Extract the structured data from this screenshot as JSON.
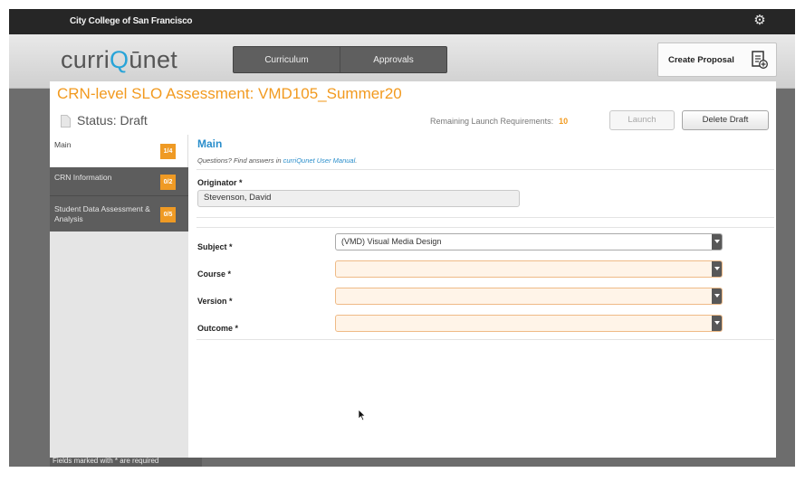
{
  "topbar": {
    "college": "City College of San Francisco",
    "settings_icon": "gear-icon"
  },
  "header": {
    "logo_prefix": "curri",
    "logo_q": "Q",
    "logo_suffix": "ūnet",
    "nav": [
      {
        "label": "Curriculum"
      },
      {
        "label": "Approvals"
      }
    ],
    "create_proposal_label": "Create Proposal",
    "create_proposal_icon": "create-proposal-icon"
  },
  "page": {
    "title": "CRN-level SLO Assessment: VMD105_Summer20",
    "status": "Status: Draft",
    "remaining_label": "Remaining Launch Requirements:",
    "remaining_count": "10",
    "launch_label": "Launch",
    "delete_label": "Delete Draft"
  },
  "sidebar": {
    "items": [
      {
        "label": "Main",
        "badge": "1/4"
      },
      {
        "label": "CRN Information",
        "badge": "0/2"
      },
      {
        "label": "Student Data Assessment & Analysis",
        "badge": "0/5"
      }
    ]
  },
  "form": {
    "title": "Main",
    "help_text": "Questions? Find answers in ",
    "help_link": "curriQunet User Manual",
    "help_end": ".",
    "originator_label": "Originator *",
    "originator_value": "Stevenson, David",
    "fields": [
      {
        "label": "Subject *",
        "value": "(VMD) Visual Media Design"
      },
      {
        "label": "Course *",
        "value": ""
      },
      {
        "label": "Version *",
        "value": ""
      },
      {
        "label": "Outcome *",
        "value": ""
      }
    ]
  },
  "footer": {
    "text": "Fields marked with * are required"
  },
  "colors": {
    "accent_orange": "#f29a1f",
    "link_blue": "#2a8ecb",
    "logo_blue": "#28a4d8",
    "dark_bar": "#262626"
  }
}
